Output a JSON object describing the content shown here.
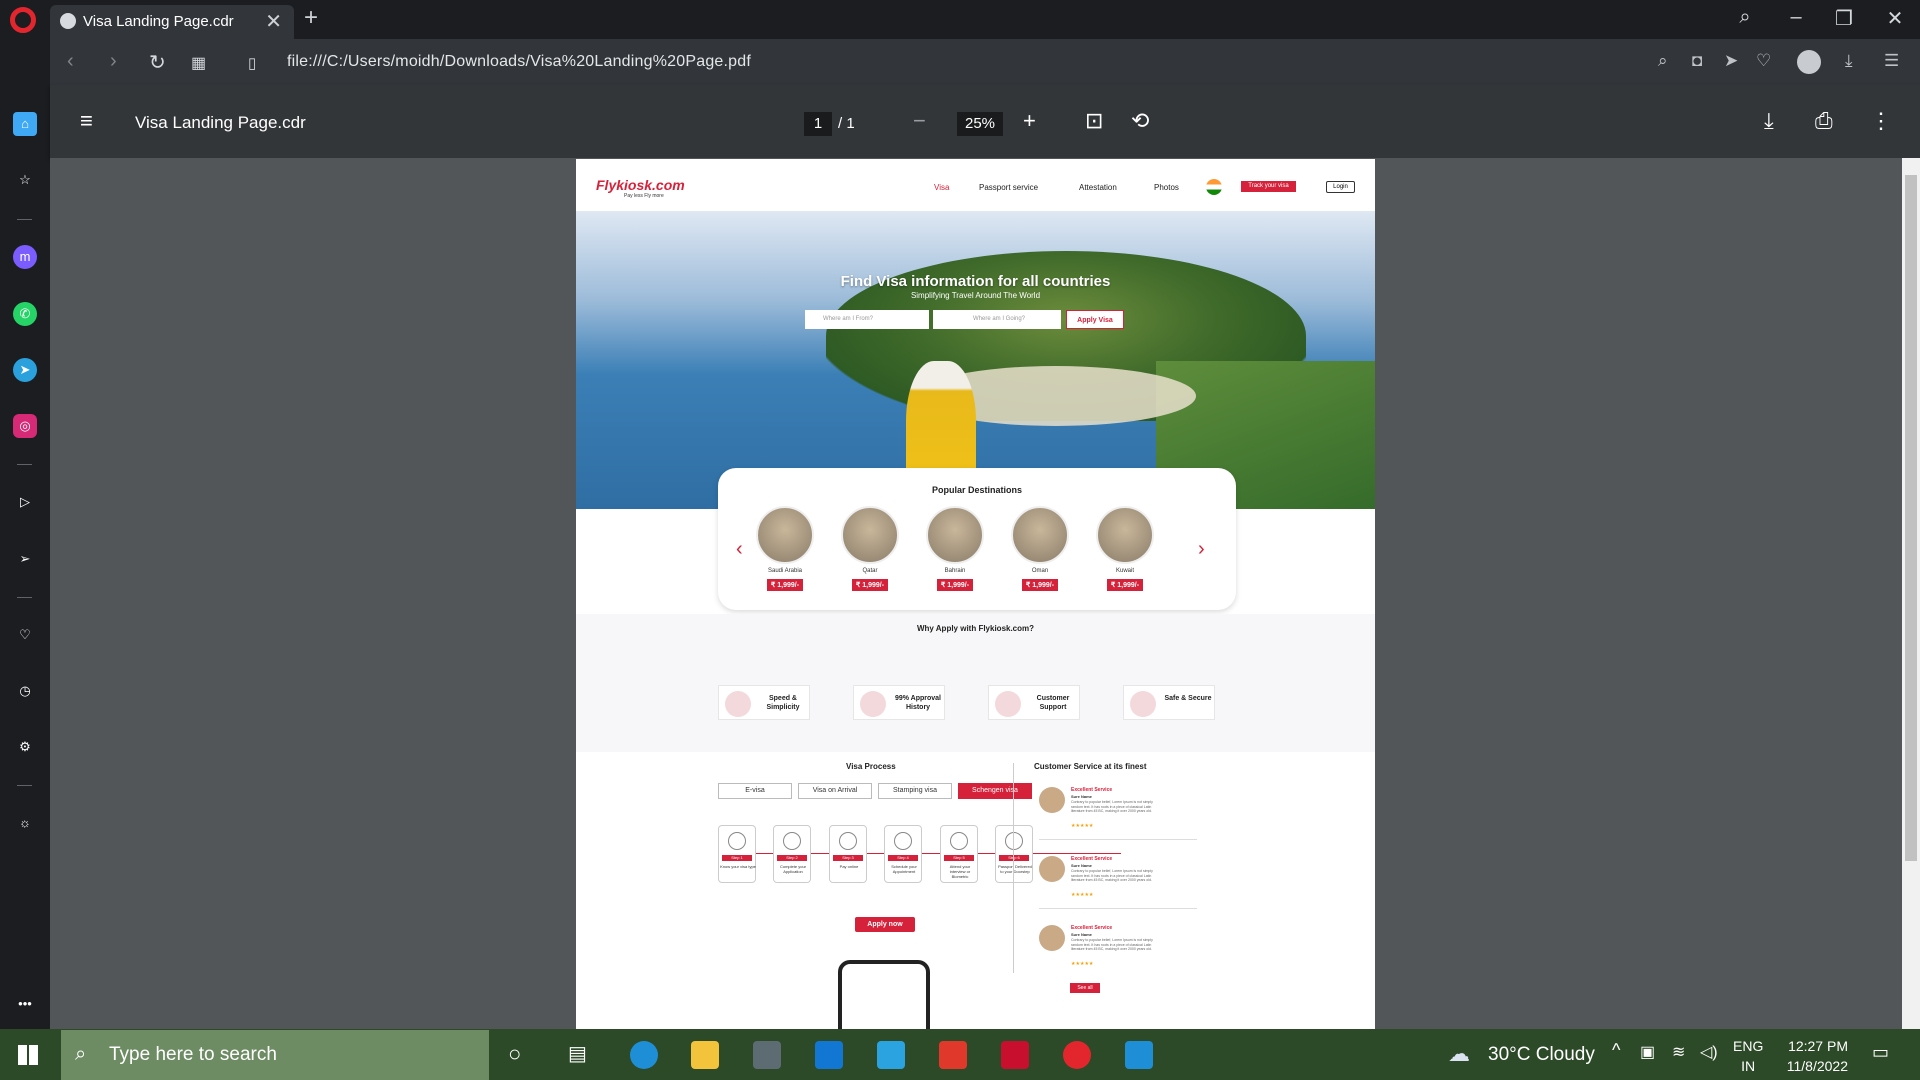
{
  "browser": {
    "tab_title": "Visa Landing Page.cdr",
    "url": "file:///C:/Users/moidh/Downloads/Visa%20Landing%20Page.pdf"
  },
  "pdf_toolbar": {
    "title": "Visa Landing Page.cdr",
    "current_page": "1",
    "page_sep": "/  1",
    "zoom": "25%"
  },
  "site": {
    "logo": "Flykiosk.com",
    "tagline": "Pay less Fly more",
    "nav": [
      "Visa",
      "Passport service",
      "Attestation",
      "Photos"
    ],
    "track_button": "Track your visa",
    "login_button": "Login",
    "hero_title": "Find Visa information for all countries",
    "hero_subtitle": "Simplifying Travel Around The World",
    "search_from_placeholder": "Where am I From?",
    "search_to_placeholder": "Where am I Going?",
    "apply_visa_button": "Apply Visa",
    "popular_title": "Popular Destinations",
    "destinations": [
      {
        "name": "Saudi Arabia",
        "price": "₹ 1,999/-"
      },
      {
        "name": "Qatar",
        "price": "₹ 1,999/-"
      },
      {
        "name": "Bahrain",
        "price": "₹ 1,999/-"
      },
      {
        "name": "Oman",
        "price": "₹ 1,999/-"
      },
      {
        "name": "Kuwait",
        "price": "₹ 1,999/-"
      }
    ],
    "why_title": "Why Apply with Flykiosk.com?",
    "why_cards": [
      "Speed & Simplicity",
      "99% Approval History",
      "Customer Support",
      "Safe & Secure"
    ],
    "process_title": "Visa Process",
    "process_tabs": [
      "E-visa",
      "Visa on Arrival",
      "Stamping visa",
      "Schengen visa"
    ],
    "steps": [
      {
        "label": "Step 1",
        "desc": "Know your visa type"
      },
      {
        "label": "Step 2",
        "desc": "Complete your Application"
      },
      {
        "label": "Step 3",
        "desc": "Pay online"
      },
      {
        "label": "Step 4",
        "desc": "Schedule your Appointment"
      },
      {
        "label": "Step 5",
        "desc": "Attend your interview or Biometric"
      },
      {
        "label": "Step 6",
        "desc": "Passport Delivered to your Doorstep"
      }
    ],
    "apply_now": "Apply now",
    "cs_title": "Customer Service at its finest",
    "reviews": [
      {
        "title": "Excellent Service",
        "name": "Sure Name",
        "text": "Contrary to popular belief, Lorem Ipsum is not simply random text. It has roots in a piece of classical Latin literature from 45 BC, making it over 2000 years old.",
        "stars": "★★★★★"
      },
      {
        "title": "Excellent Service",
        "name": "Sure Name",
        "text": "Contrary to popular belief, Lorem Ipsum is not simply random text. It has roots in a piece of classical Latin literature from 45 BC, making it over 2000 years old.",
        "stars": "★★★★★"
      },
      {
        "title": "Excellent Service",
        "name": "Sure Name",
        "text": "Contrary to popular belief, Lorem Ipsum is not simply random text. It has roots in a piece of classical Latin literature from 45 BC, making it over 2000 years old.",
        "stars": "★★★★★"
      }
    ],
    "see_all": "See all"
  },
  "taskbar": {
    "search_placeholder": "Type here to search",
    "weather": "30°C  Cloudy",
    "lang": "ENG",
    "region": "IN",
    "time": "12:27 PM",
    "date": "11/8/2022"
  },
  "colors": {
    "brand_red": "#d6213a",
    "taskbar": "#2c4a27"
  }
}
